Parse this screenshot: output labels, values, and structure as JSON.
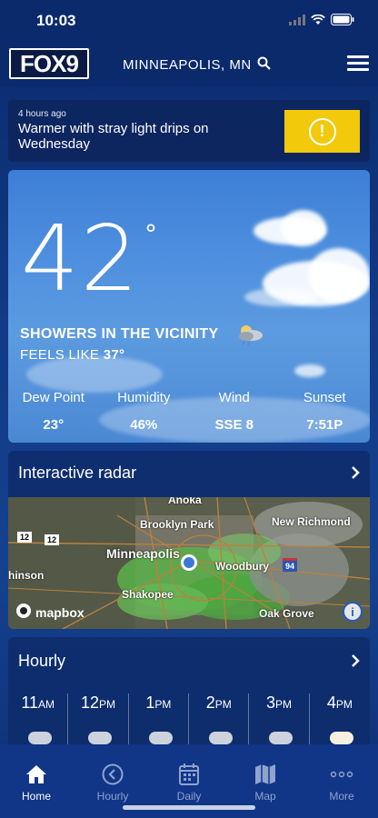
{
  "status_bar": {
    "time": "10:03"
  },
  "header": {
    "logo_text": "FOX9",
    "location": "MINNEAPOLIS, MN",
    "search_icon": "search-icon",
    "menu_icon": "hamburger-menu-icon"
  },
  "alert": {
    "time": "4 hours ago",
    "text": "Warmer with stray light drips on Wednesday",
    "button_icon": "alert-exclamation-icon",
    "button_color": "#f2c90b",
    "button_symbol": "!"
  },
  "current": {
    "temperature": "42",
    "degree": "°",
    "condition": "SHOWERS IN THE VICINITY",
    "condition_icon": "sun-clouds-rain-icon",
    "feels_like_label": "FEELS LIKE",
    "feels_like_value": "37°",
    "stats": [
      {
        "label": "Dew Point",
        "value": "23°"
      },
      {
        "label": "Humidity",
        "value": "46%"
      },
      {
        "label": "Wind",
        "value": "SSE 8"
      },
      {
        "label": "Sunset",
        "value": "7:51P"
      }
    ]
  },
  "radar": {
    "title": "Interactive radar",
    "map_labels": [
      "Anoka",
      "Brooklyn Park",
      "New Richmond",
      "Minneapolis",
      "Woodbury",
      "Shakopee",
      "Oak Grove",
      "hinson"
    ],
    "shields": [
      "12",
      "12",
      "94"
    ],
    "attribution": "mapbox",
    "info_symbol": "i"
  },
  "hourly": {
    "title": "Hourly",
    "hours": [
      {
        "num": "11",
        "ampm": "AM"
      },
      {
        "num": "12",
        "ampm": "PM"
      },
      {
        "num": "1",
        "ampm": "PM"
      },
      {
        "num": "2",
        "ampm": "PM"
      },
      {
        "num": "3",
        "ampm": "PM"
      },
      {
        "num": "4",
        "ampm": "PM"
      }
    ]
  },
  "tabs": [
    {
      "label": "Home",
      "icon": "home-icon",
      "active": true
    },
    {
      "label": "Hourly",
      "icon": "clock-back-icon",
      "active": false
    },
    {
      "label": "Daily",
      "icon": "calendar-icon",
      "active": false
    },
    {
      "label": "Map",
      "icon": "map-icon",
      "active": false
    },
    {
      "label": "More",
      "icon": "more-dots-icon",
      "active": false
    }
  ]
}
